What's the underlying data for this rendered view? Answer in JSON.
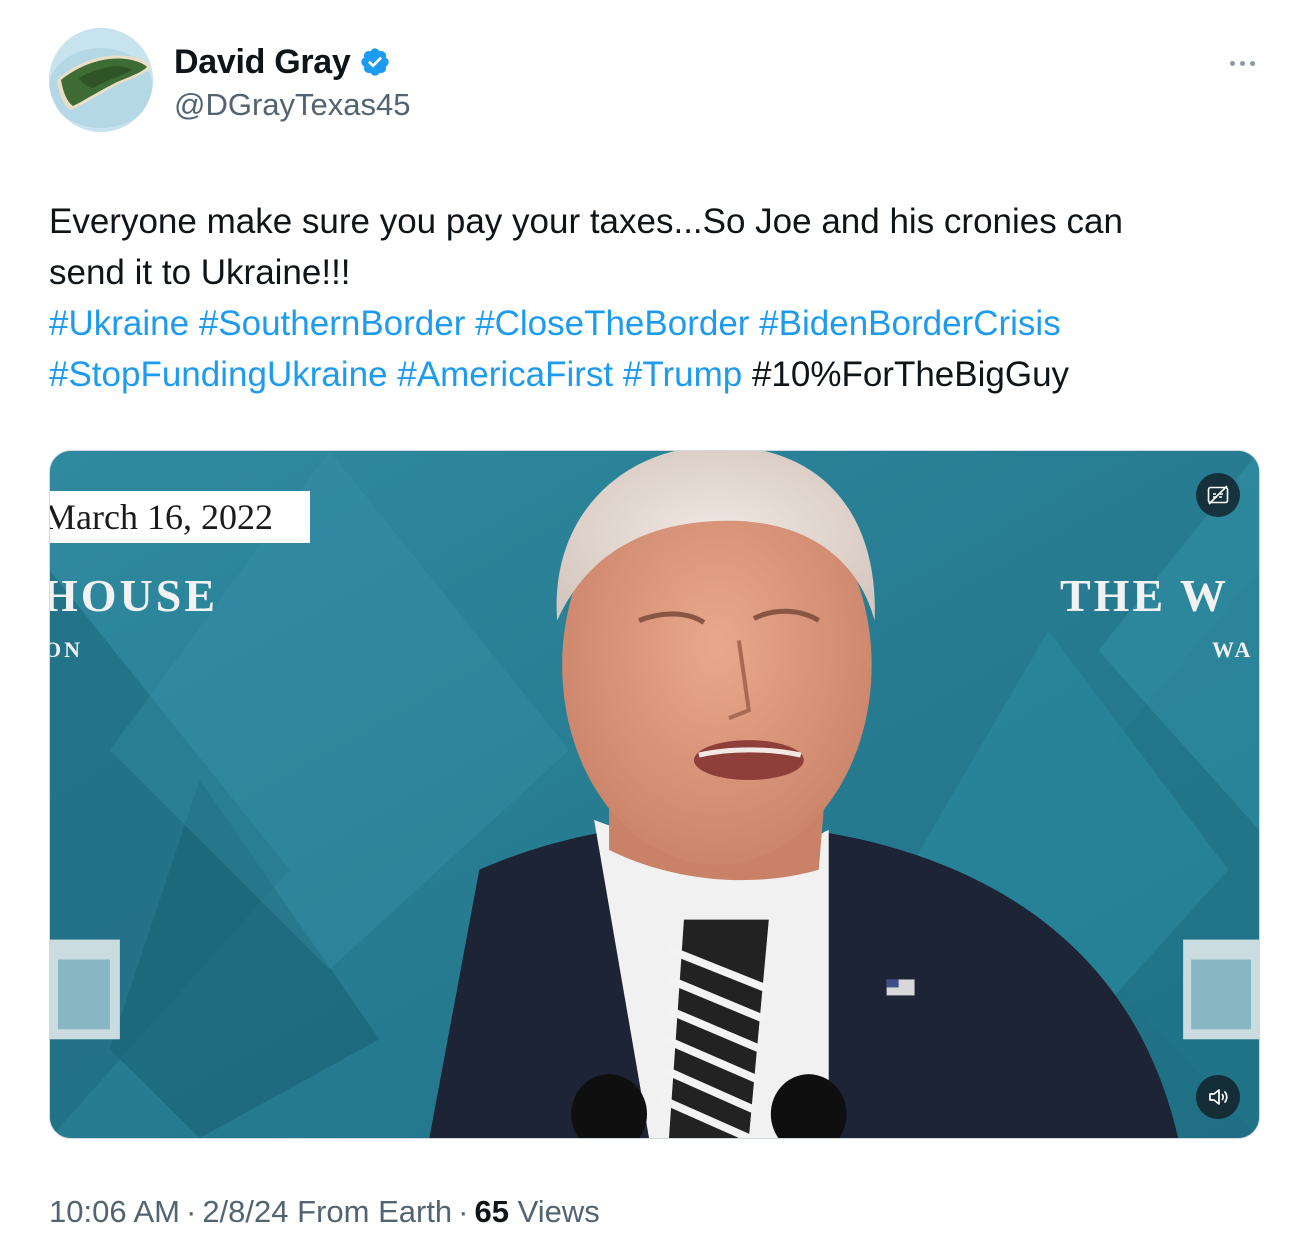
{
  "author": {
    "display_name": "David Gray",
    "handle": "@DGrayTexas45",
    "verified": true,
    "verified_color": "#1d9bf0",
    "avatar": "island-aerial-photo"
  },
  "more_menu_icon": "ellipsis-icon",
  "tweet": {
    "text_line_1": "Everyone make sure you pay your taxes...So Joe and his cronies can",
    "text_line_2": "send it to Ukraine!!!",
    "hashtags_line_1": [
      "#Ukraine",
      "#SouthernBorder",
      "#CloseTheBorder",
      "#BidenBorderCrisis"
    ],
    "hashtags_line_2": [
      "#StopFundingUkraine",
      "#AmericaFirst",
      "#Trump"
    ],
    "plain_tag": "#10%ForTheBigGuy",
    "hashtag_color": "#1d9bf0"
  },
  "media": {
    "type": "video",
    "date_overlay": "March 16, 2022",
    "left_sign": "HOUSE",
    "left_sign_sub": "ON",
    "right_sign": "THE W",
    "right_sign_sub": "WA",
    "captions_icon": "captions-off-icon",
    "mute_icon": "speaker-icon"
  },
  "meta": {
    "time": "10:06 AM",
    "date": "2/8/24",
    "source": "From Earth",
    "views_count": "65",
    "views_label": "Views"
  }
}
